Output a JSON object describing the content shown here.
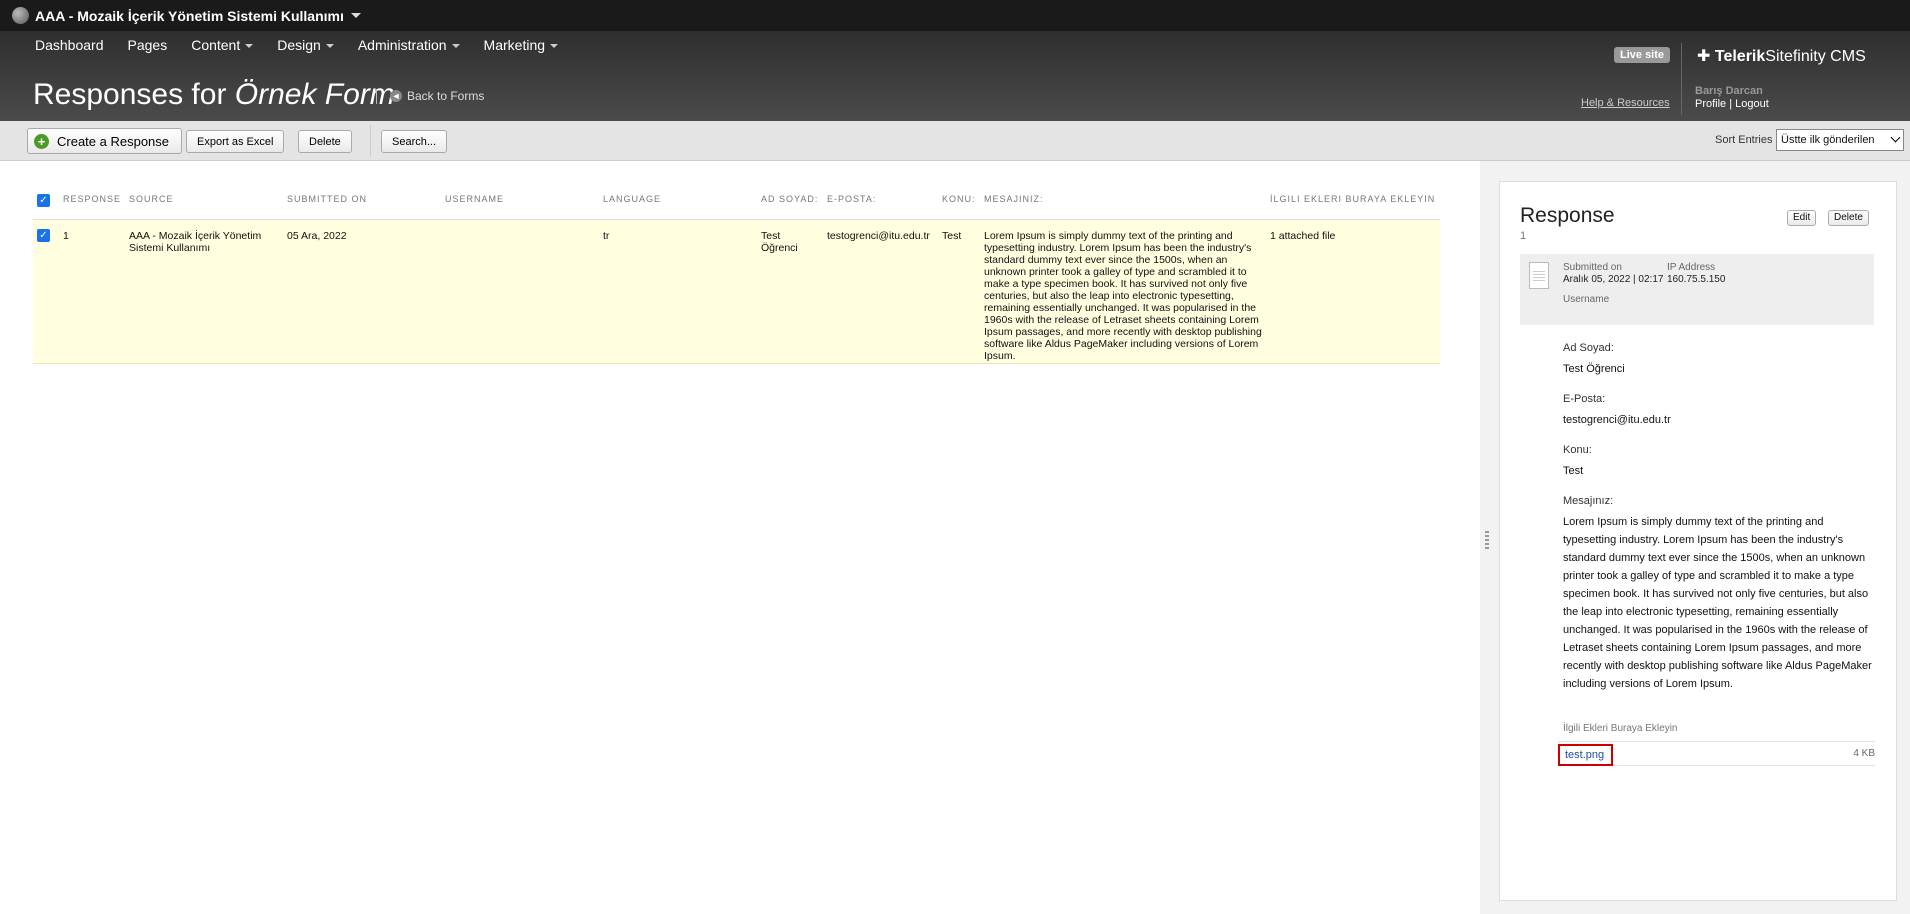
{
  "site": {
    "title": "AAA - Mozaik İçerik Yönetim Sistemi Kullanımı"
  },
  "nav": {
    "items": [
      {
        "label": "Dashboard",
        "dropdown": false
      },
      {
        "label": "Pages",
        "dropdown": false
      },
      {
        "label": "Content",
        "dropdown": true
      },
      {
        "label": "Design",
        "dropdown": true
      },
      {
        "label": "Administration",
        "dropdown": true
      },
      {
        "label": "Marketing",
        "dropdown": true
      }
    ]
  },
  "header": {
    "title_prefix": "Responses for",
    "title_form": "Örnek Form",
    "back_label": "Back to Forms",
    "live_site": "Live site",
    "brand_bold": "Telerik",
    "brand_rest": "Sitefinity CMS",
    "help": "Help & Resources",
    "user_name": "Barış Darcan",
    "profile": "Profile",
    "logout": "Logout"
  },
  "toolbar": {
    "create": "Create a Response",
    "export": "Export as Excel",
    "delete": "Delete",
    "search": "Search...",
    "sort_label": "Sort Entries",
    "sort_value": "Üstte ilk gönderilen"
  },
  "grid": {
    "headers": {
      "response": "RESPONSE",
      "source": "SOURCE",
      "submitted_on": "SUBMITTED ON",
      "username": "USERNAME",
      "language": "LANGUAGE",
      "ad_soyad": "AD SOYAD:",
      "eposta": "E-POSTA:",
      "konu": "KONU:",
      "mesaj": "MESAJINIZ:",
      "ekler": "İLGILI EKLERI BURAYA EKLEYIN"
    },
    "row": {
      "response": "1",
      "source": "AAA - Mozaik İçerik Yönetim Sistemi Kullanımı",
      "submitted_on": "05 Ara, 2022",
      "username": "",
      "language": "tr",
      "ad_soyad": "Test Öğrenci",
      "eposta": "testogrenci@itu.edu.tr",
      "konu": "Test",
      "mesaj": "Lorem Ipsum is simply dummy text of the printing and typesetting industry. Lorem Ipsum has been the industry's standard dummy text ever since the 1500s, when an unknown printer took a galley of type and scrambled it to make a type specimen book. It has survived not only five centuries, but also the leap into electronic typesetting, remaining essentially unchanged. It was popularised in the 1960s with the release of Letraset sheets containing Lorem Ipsum passages, and more recently with desktop publishing software like Aldus PageMaker including versions of Lorem Ipsum.",
      "ekler": "1 attached file"
    }
  },
  "panel": {
    "title": "Response",
    "number": "1",
    "edit": "Edit",
    "delete": "Delete",
    "submitted_label": "Submitted on",
    "submitted_value": "Aralık 05, 2022 | 02:17",
    "ip_label": "IP Address",
    "ip_value": "160.75.5.150",
    "username_label": "Username",
    "fields": [
      {
        "label": "Ad Soyad:",
        "value": "Test Öğrenci"
      },
      {
        "label": "E-Posta:",
        "value": "testogrenci@itu.edu.tr"
      },
      {
        "label": "Konu:",
        "value": "Test"
      },
      {
        "label": "Mesajınız:",
        "value": "Lorem Ipsum is simply dummy text of the printing and typesetting industry. Lorem Ipsum has been the industry's standard dummy text ever since the 1500s, when an unknown printer took a galley of type and scrambled it to make a type specimen book. It has survived not only five centuries, but also the leap into electronic typesetting, remaining essentially unchanged. It was popularised in the 1960s with the release of Letraset sheets containing Lorem Ipsum passages, and more recently with desktop publishing software like Aldus PageMaker including versions of Lorem Ipsum."
      }
    ],
    "attach_label": "İlgili Ekleri Buraya Ekleyin",
    "attach_file": "test.png",
    "attach_size": "4 KB"
  }
}
